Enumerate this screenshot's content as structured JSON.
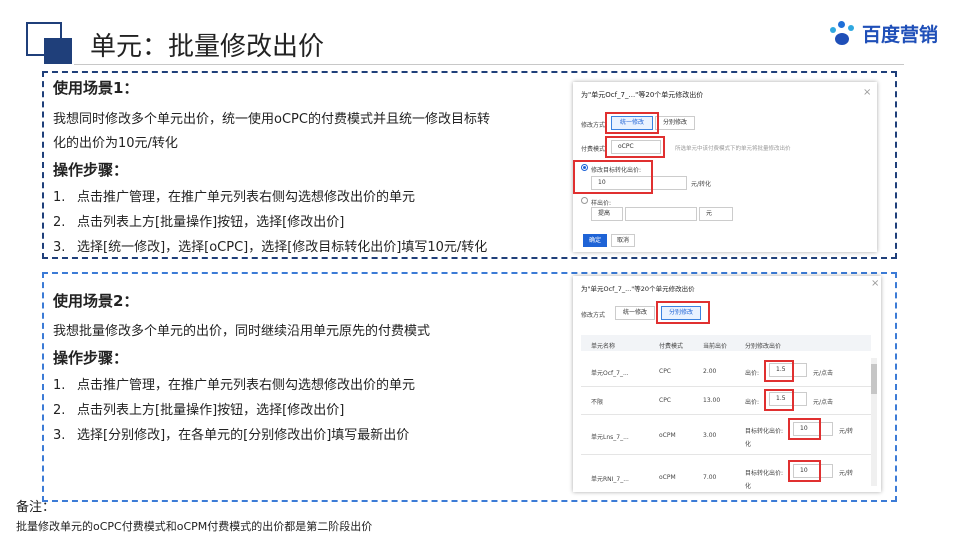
{
  "header": {
    "title": "单元：批量修改出价",
    "brand": "百度营销"
  },
  "scene1": {
    "heading": "使用场景1：",
    "desc_line1": "我想同时修改多个单元出价，统一使用oCPC的付费模式并且统一修改目标转",
    "desc_line2": "化的出价为10元/转化",
    "steps_heading": "操作步骤：",
    "steps": [
      {
        "num": "1.",
        "text": "点击推广管理，在推广单元列表右侧勾选想修改出价的单元"
      },
      {
        "num": "2.",
        "text": "点击列表上方[批量操作]按钮，选择[修改出价]"
      },
      {
        "num": "3.",
        "text": "选择[统一修改]，选择[oCPC]，选择[修改目标转化出价]填写10元/转化"
      }
    ]
  },
  "scene2": {
    "heading": "使用场景2：",
    "desc": "我想批量修改多个单元的出价，同时继续沿用单元原先的付费模式",
    "steps_heading": "操作步骤：",
    "steps": [
      {
        "num": "1.",
        "text": "点击推广管理，在推广单元列表右侧勾选想修改出价的单元"
      },
      {
        "num": "2.",
        "text": "点击列表上方[批量操作]按钮，选择[修改出价]"
      },
      {
        "num": "3.",
        "text": "选择[分别修改]，在各单元的[分别修改出价]填写最新出价"
      }
    ]
  },
  "dialog1": {
    "title": "为\"单元Ocf_7_...\"等20个单元修改出价",
    "close": "×",
    "mode_label": "修改方式:",
    "mode_unified": "统一修改",
    "mode_separate": "分别修改",
    "pay_label": "付费模式:",
    "pay_value": "oCPC",
    "pay_hint": "所选单元中该付费模式下的单元将批量修改出价",
    "target_radio": "修改目标转化出价:",
    "target_value": "10",
    "target_unit": "元/转化",
    "bid_radio": "样出价:",
    "bid_select": "提高",
    "bid_unit": "元",
    "confirm": "确定",
    "cancel": "取消"
  },
  "dialog2": {
    "title": "为\"单元Ocf_7_...\"等20个单元修改出价",
    "close": "×",
    "mode_label": "修改方式",
    "mode_unified": "统一修改",
    "mode_separate": "分别修改",
    "columns": [
      "单元名称",
      "付费模式",
      "当前出价",
      "分别修改出价"
    ],
    "rows": [
      {
        "name": "单元Ocf_7_...",
        "mode": "CPC",
        "price": "2.00",
        "label": "出价:",
        "value": "1.5",
        "unit": "元/点击"
      },
      {
        "name": "不限",
        "mode": "CPC",
        "price": "13.00",
        "label": "出价:",
        "value": "1.5",
        "unit": "元/点击"
      },
      {
        "name": "单元Lns_7_...",
        "mode": "oCPM",
        "price": "3.00",
        "label": "目标转化出价:",
        "value": "10",
        "unit": "元/转",
        "unit2": "化"
      },
      {
        "name": "单元RNI_7_...",
        "mode": "oCPM",
        "price": "7.00",
        "label": "目标转化出价:",
        "value": "10",
        "unit": "元/转",
        "unit2": "化"
      }
    ]
  },
  "note": {
    "label": "备注：",
    "text": "批量修改单元的oCPC付费模式和oCPM付费模式的出价都是第二阶段出价"
  },
  "colors": {
    "navy": "#1f3f7a",
    "blue_dash": "#3c7bd6",
    "highlight": "#e03030",
    "brand": "#1f4fb8"
  }
}
